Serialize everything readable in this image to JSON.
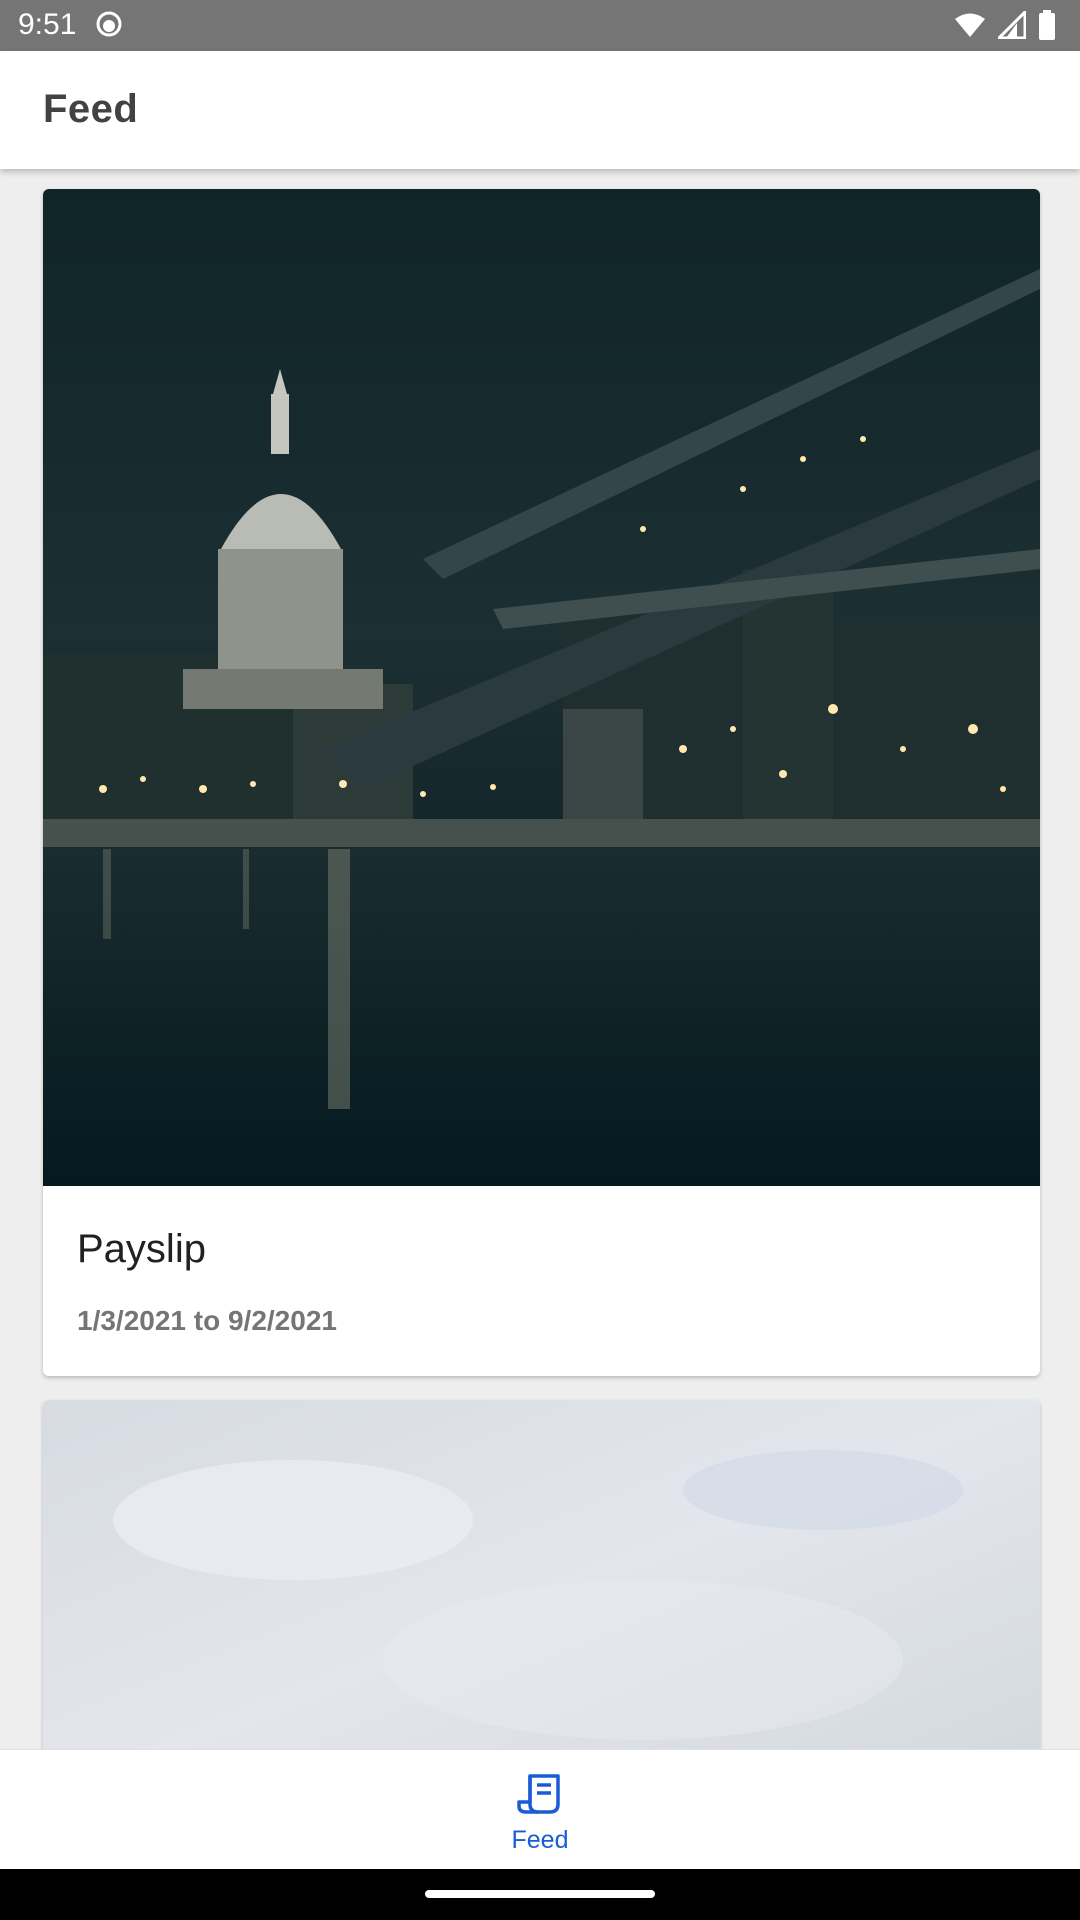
{
  "status_bar": {
    "time": "9:51",
    "icons": [
      "notification-app-icon",
      "wifi-icon",
      "cellular-signal-icon",
      "battery-icon"
    ]
  },
  "app_bar": {
    "title": "Feed"
  },
  "feed": {
    "cards": [
      {
        "image": "night-city-bridge-photo",
        "title": "Payslip",
        "date_range": "1/3/2021 to 9/2/2021"
      },
      {
        "image": "cloudy-sky-photo"
      }
    ]
  },
  "bottom_nav": {
    "items": [
      {
        "label": "Feed",
        "icon": "feed-receipt-icon",
        "selected": true
      }
    ]
  },
  "colors": {
    "status_bar": "#757575",
    "accent": "#1a5bd6",
    "background": "#eeeeee"
  }
}
